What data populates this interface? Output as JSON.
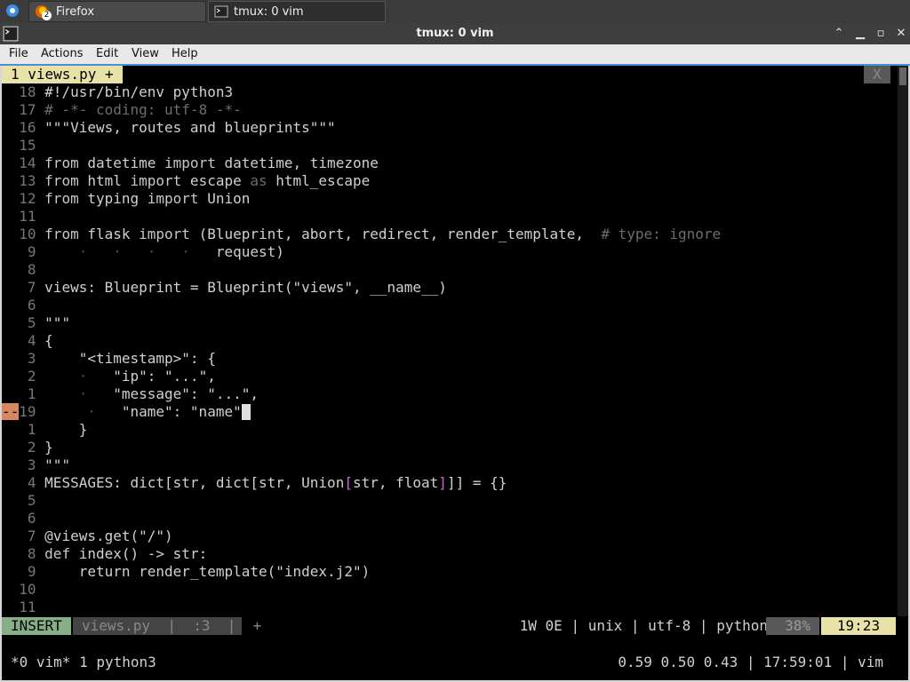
{
  "taskbar": {
    "firefox_label": "Firefox",
    "firefox_badge": "2",
    "tmux_label": "tmux: 0 vim"
  },
  "window": {
    "title": "tmux: 0 vim"
  },
  "menu": [
    "File",
    "Actions",
    "Edit",
    "View",
    "Help"
  ],
  "vim": {
    "tab_label": "1 views.py +",
    "tab_close": "X",
    "lines": [
      {
        "n": "18",
        "segs": [
          [
            "t",
            "#!/usr/bin/env python3"
          ]
        ]
      },
      {
        "n": "17",
        "segs": [
          [
            "cm",
            "# -*- coding: utf-8 -*-"
          ]
        ]
      },
      {
        "n": "16",
        "segs": [
          [
            "t",
            "\"\"\"Views, routes and blueprints\"\"\""
          ]
        ]
      },
      {
        "n": "15",
        "segs": []
      },
      {
        "n": "14",
        "segs": [
          [
            "kw",
            "from"
          ],
          [
            "t",
            " datetime "
          ],
          [
            "kw",
            "import"
          ],
          [
            "t",
            " datetime, timezone"
          ]
        ]
      },
      {
        "n": "13",
        "segs": [
          [
            "kw",
            "from"
          ],
          [
            "t",
            " html "
          ],
          [
            "kw",
            "import"
          ],
          [
            "t",
            " escape "
          ],
          [
            "cm",
            "as"
          ],
          [
            "t",
            " html_escape"
          ]
        ]
      },
      {
        "n": "12",
        "segs": [
          [
            "kw",
            "from"
          ],
          [
            "t",
            " typing "
          ],
          [
            "kw",
            "import"
          ],
          [
            "t",
            " Union"
          ]
        ]
      },
      {
        "n": "11",
        "segs": []
      },
      {
        "n": "10",
        "segs": [
          [
            "kw",
            "from"
          ],
          [
            "t",
            " flask "
          ],
          [
            "kw",
            "import"
          ],
          [
            "t",
            " (Blueprint, abort, redirect, render_template,  "
          ],
          [
            "cm",
            "# type: ignore"
          ]
        ]
      },
      {
        "n": "9",
        "segs": [
          [
            "dot",
            "    ·   ·   ·   ·   "
          ],
          [
            "t",
            "request)"
          ]
        ]
      },
      {
        "n": "8",
        "segs": []
      },
      {
        "n": "7",
        "segs": [
          [
            "t",
            "views: Blueprint = Blueprint(\"views\", __name__)"
          ]
        ]
      },
      {
        "n": "6",
        "segs": []
      },
      {
        "n": "5",
        "segs": [
          [
            "t",
            "\"\"\""
          ]
        ]
      },
      {
        "n": "4",
        "segs": [
          [
            "t",
            "{"
          ]
        ]
      },
      {
        "n": "3",
        "segs": [
          [
            "t",
            "    \"<timestamp>\": {"
          ]
        ]
      },
      {
        "n": "2",
        "segs": [
          [
            "dot",
            "    ·   "
          ],
          [
            "t",
            "\"ip\": \"...\","
          ]
        ]
      },
      {
        "n": "1",
        "segs": [
          [
            "dot",
            "    ·   "
          ],
          [
            "t",
            "\"message\": \"...\","
          ]
        ]
      },
      {
        "n": "--19",
        "cur": true,
        "segs": [
          [
            "dot",
            "    ·   "
          ],
          [
            "t",
            "\"name\": \"name\""
          ]
        ]
      },
      {
        "n": "1",
        "segs": [
          [
            "t",
            "    }"
          ]
        ]
      },
      {
        "n": "2",
        "segs": [
          [
            "t",
            "}"
          ]
        ]
      },
      {
        "n": "3",
        "segs": [
          [
            "t",
            "\"\"\""
          ]
        ]
      },
      {
        "n": "4",
        "segs": [
          [
            "t",
            "MESSAGES: dict[str, dict[str, Union"
          ],
          [
            "mg",
            "["
          ],
          [
            "t",
            "str, float"
          ],
          [
            "mg",
            "]"
          ],
          [
            "t",
            "]] = {}"
          ]
        ]
      },
      {
        "n": "5",
        "segs": []
      },
      {
        "n": "6",
        "segs": []
      },
      {
        "n": "7",
        "segs": [
          [
            "t",
            "@views.get(\"/\")"
          ]
        ]
      },
      {
        "n": "8",
        "segs": [
          [
            "kw",
            "def"
          ],
          [
            "t",
            " index() -> str:"
          ]
        ]
      },
      {
        "n": "9",
        "segs": [
          [
            "t",
            "    return render_template(\"index.j2\")"
          ]
        ]
      },
      {
        "n": "10",
        "segs": []
      },
      {
        "n": "11",
        "segs": []
      }
    ],
    "status": {
      "mode": "INSERT",
      "file": "views.py  |  :3  |  +",
      "info": "1W 0E | unix | utf-8 | python",
      "percent": "38%",
      "position": "19:23"
    }
  },
  "tmux": {
    "left": "*0 vim* 1 python3",
    "right": "0.59 0.50 0.43 | 17:59:01 | vim"
  }
}
